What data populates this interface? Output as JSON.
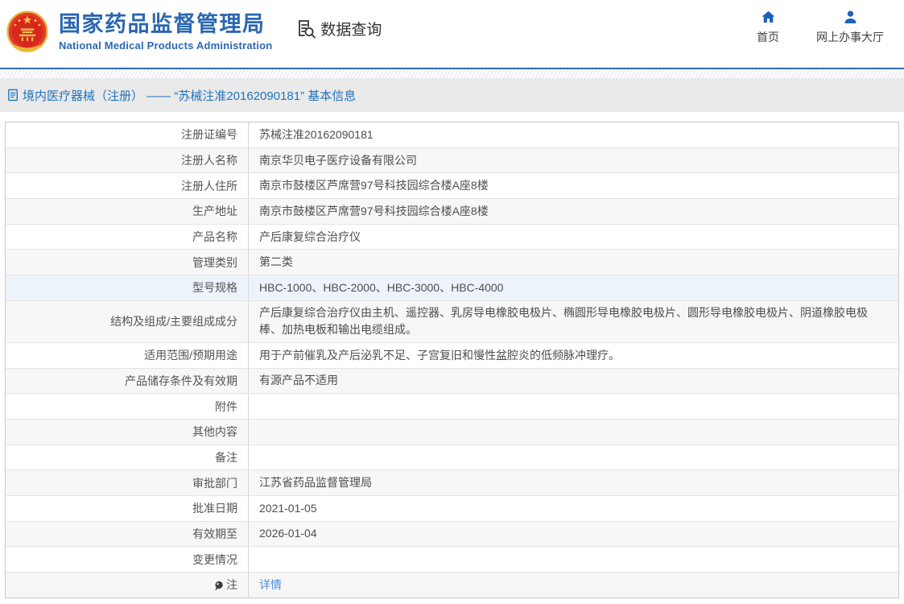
{
  "header": {
    "brand": {
      "title": "国家药品监督管理局",
      "subtitle": "National Medical Products Administration"
    },
    "section_label": "数据查询",
    "nav": [
      {
        "label": "首页",
        "icon": "home-icon"
      },
      {
        "label": "网上办事大厅",
        "icon": "user-icon"
      }
    ]
  },
  "breadcrumb": {
    "icon": "document-icon",
    "text": "境内医疗器械（注册） —— “苏械注准20162090181” 基本信息"
  },
  "table": {
    "rows": [
      {
        "label": "注册证编号",
        "value": "苏械注准20162090181"
      },
      {
        "label": "注册人名称",
        "value": "南京华贝电子医疗设备有限公司"
      },
      {
        "label": "注册人住所",
        "value": "南京市鼓楼区芦席营97号科技园综合楼A座8楼"
      },
      {
        "label": "生产地址",
        "value": "南京市鼓楼区芦席营97号科技园综合楼A座8楼"
      },
      {
        "label": "产品名称",
        "value": "产后康复综合治疗仪"
      },
      {
        "label": "管理类别",
        "value": "第二类"
      },
      {
        "label": "型号规格",
        "value": "HBC-1000、HBC-2000、HBC-3000、HBC-4000"
      },
      {
        "label": "结构及组成/主要组成成分",
        "value": "产后康复综合治疗仪由主机、遥控器、乳房导电橡胶电极片、椭圆形导电橡胶电极片、圆形导电橡胶电极片、阴道橡胶电极棒、加热电板和输出电缆组成。"
      },
      {
        "label": "适用范围/预期用途",
        "value": "用于产前催乳及产后泌乳不足、子宫复旧和慢性盆腔炎的低频脉冲理疗。"
      },
      {
        "label": "产品储存条件及有效期",
        "value": "有源产品不适用"
      },
      {
        "label": "附件",
        "value": ""
      },
      {
        "label": "其他内容",
        "value": ""
      },
      {
        "label": "备注",
        "value": ""
      },
      {
        "label": "审批部门",
        "value": "江苏省药品监督管理局"
      },
      {
        "label": "批准日期",
        "value": "2021-01-05"
      },
      {
        "label": "有效期至",
        "value": "2026-01-04"
      },
      {
        "label": "变更情况",
        "value": ""
      },
      {
        "label": "注",
        "icon": "note-icon",
        "value": "详情"
      }
    ]
  },
  "icons": [
    "national-emblem-icon",
    "doc-search-icon",
    "home-icon",
    "user-icon",
    "document-icon",
    "note-icon"
  ],
  "colors": {
    "brand_blue": "#2b67b1",
    "header_line_blue": "#2a6cb5",
    "breadcrumb_blue": "#2273bc",
    "link_blue": "#4a90d9",
    "emblem_red": "#de2b20",
    "row_alt_gray": "#f7f7f7",
    "row_highlight_blue": "#edf3fa",
    "breadcrumb_band_gray": "#eaeaea"
  }
}
